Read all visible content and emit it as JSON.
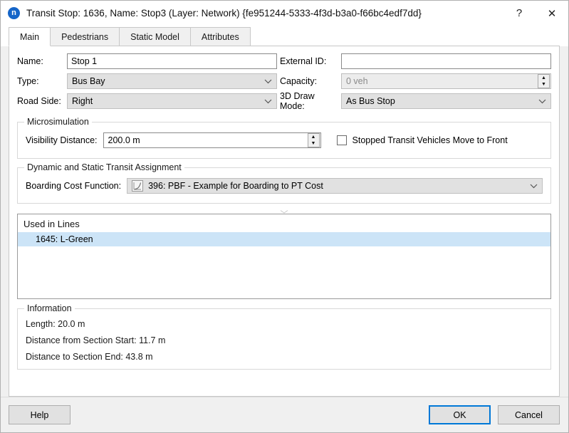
{
  "window": {
    "icon_letter": "n",
    "title": "Transit Stop: 1636, Name: Stop3 (Layer: Network) {fe951244-5333-4f3d-b3a0-f66bc4edf7dd}",
    "help_glyph": "?",
    "close_glyph": "✕"
  },
  "tabs": [
    {
      "label": "Main"
    },
    {
      "label": "Pedestrians"
    },
    {
      "label": "Static Model"
    },
    {
      "label": "Attributes"
    }
  ],
  "main": {
    "name": {
      "label": "Name:",
      "value": "Stop 1"
    },
    "external_id": {
      "label": "External ID:",
      "value": ""
    },
    "type": {
      "label": "Type:",
      "value": "Bus Bay"
    },
    "capacity": {
      "label": "Capacity:",
      "value": "0 veh"
    },
    "road_side": {
      "label": "Road Side:",
      "value": "Right"
    },
    "draw_mode": {
      "label": "3D Draw Mode:",
      "value": "As Bus Stop"
    },
    "microsimulation": {
      "title": "Microsimulation",
      "visibility_distance": {
        "label": "Visibility Distance:",
        "value": "200.0 m"
      },
      "move_to_front": {
        "label": "Stopped Transit Vehicles Move to Front",
        "checked": false
      }
    },
    "assignment": {
      "title": "Dynamic and Static Transit Assignment",
      "boarding_cost": {
        "label": "Boarding Cost Function:",
        "value": "396: PBF - Example for Boarding to PT Cost"
      }
    },
    "used_in_lines": {
      "title": "Used in Lines",
      "rows": [
        {
          "label": "1645: L-Green",
          "selected": true
        }
      ]
    },
    "information": {
      "title": "Information",
      "lines": [
        "Length: 20.0 m",
        "Distance from Section Start: 11.7 m",
        "Distance to Section End: 43.8 m"
      ]
    }
  },
  "footer": {
    "help_label": "Help",
    "ok_label": "OK",
    "cancel_label": "Cancel"
  },
  "colors": {
    "accent": "#0078d7",
    "selection": "#cce4f7",
    "app_icon": "#1565c8"
  }
}
